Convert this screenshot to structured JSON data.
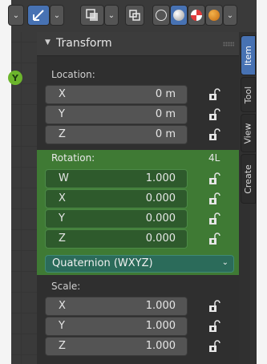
{
  "panel": {
    "title": "Transform"
  },
  "viewport_axis": {
    "label": "Y",
    "color": "#6cb52c"
  },
  "location": {
    "label": "Location:",
    "fields": [
      {
        "axis": "X",
        "value": "0 m"
      },
      {
        "axis": "Y",
        "value": "0 m"
      },
      {
        "axis": "Z",
        "value": "0 m"
      }
    ]
  },
  "rotation": {
    "label": "Rotation:",
    "keyed_label": "4L",
    "fields": [
      {
        "axis": "W",
        "value": "1.000"
      },
      {
        "axis": "X",
        "value": "0.000"
      },
      {
        "axis": "Y",
        "value": "0.000"
      },
      {
        "axis": "Z",
        "value": "0.000"
      }
    ],
    "mode": "Quaternion (WXYZ)",
    "highlight_color": "#3f7a34"
  },
  "scale": {
    "label": "Scale:",
    "fields": [
      {
        "axis": "X",
        "value": "1.000"
      },
      {
        "axis": "Y",
        "value": "1.000"
      },
      {
        "axis": "Z",
        "value": "1.000"
      }
    ]
  },
  "tabs": [
    {
      "label": "Item",
      "active": true
    },
    {
      "label": "Tool",
      "active": false
    },
    {
      "label": "View",
      "active": false
    },
    {
      "label": "Create",
      "active": false
    }
  ],
  "header_icons": [
    "transform-gizmo-icon",
    "overlay-icon",
    "xray-icon",
    "wireframe-shading-icon",
    "solid-shading-icon",
    "material-shading-icon",
    "rendered-shading-icon"
  ],
  "accent": "#4772b3"
}
